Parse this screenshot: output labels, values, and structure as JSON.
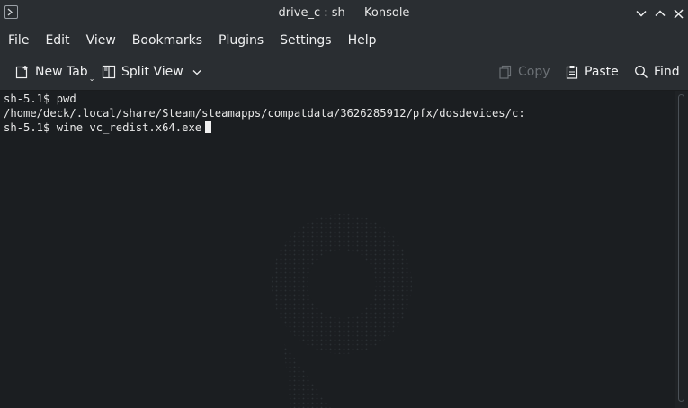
{
  "window": {
    "title": "drive_c : sh — Konsole",
    "icon": "terminal-icon"
  },
  "menu": [
    "File",
    "Edit",
    "View",
    "Bookmarks",
    "Plugins",
    "Settings",
    "Help"
  ],
  "toolbar": {
    "new_tab": "New Tab",
    "split_view": "Split View",
    "copy": "Copy",
    "paste": "Paste",
    "find": "Find"
  },
  "terminal": {
    "lines": [
      "sh-5.1$ pwd",
      "/home/deck/.local/share/Steam/steamapps/compatdata/3626285912/pfx/dosdevices/c:",
      "sh-5.1$ wine vc_redist.x64.exe"
    ]
  },
  "colors": {
    "background": "#1b1e21",
    "chrome": "#2a2e32",
    "text": "#e8e8e8",
    "disabled_text": "#6b7075"
  }
}
